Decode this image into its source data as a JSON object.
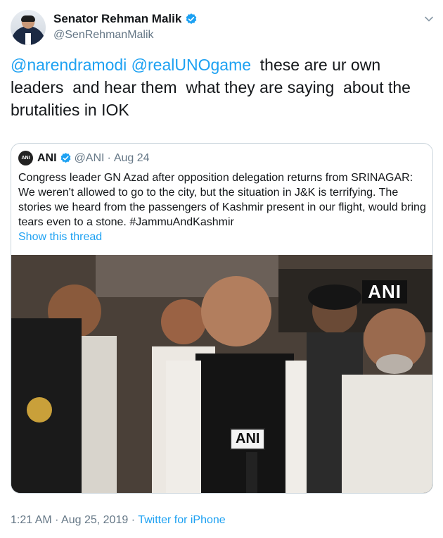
{
  "tweet": {
    "display_name": "Senator Rehman Malik",
    "handle": "@SenRehmanMalik",
    "mention_1": "@narendramodi",
    "mention_2": "@realUNOgame",
    "body": "  these are ur own leaders  and hear them  what they are saying  about the brutalities in IOK",
    "time": "1:21 AM",
    "separator": "·",
    "date": "Aug 25, 2019",
    "source": "Twitter for iPhone"
  },
  "quote": {
    "logo_text": "ANI",
    "display_name": "ANI",
    "handle": "@ANI",
    "separator": "·",
    "date": "Aug 24",
    "text": "Congress leader GN Azad after opposition delegation returns from SRINAGAR: We weren't allowed to go to the city, but the situation in J&K is terrifying. The stories we heard from the passengers of Kashmir present in our flight, would bring tears even to a stone. #JammuAndKashmir",
    "show_thread": "Show this thread",
    "media": {
      "watermark": "ANI",
      "mic_label": "ANI"
    }
  },
  "colors": {
    "link": "#1da1f2",
    "secondary_text": "#657786",
    "verified": "#1da1f2",
    "border": "#ccd6dd"
  }
}
